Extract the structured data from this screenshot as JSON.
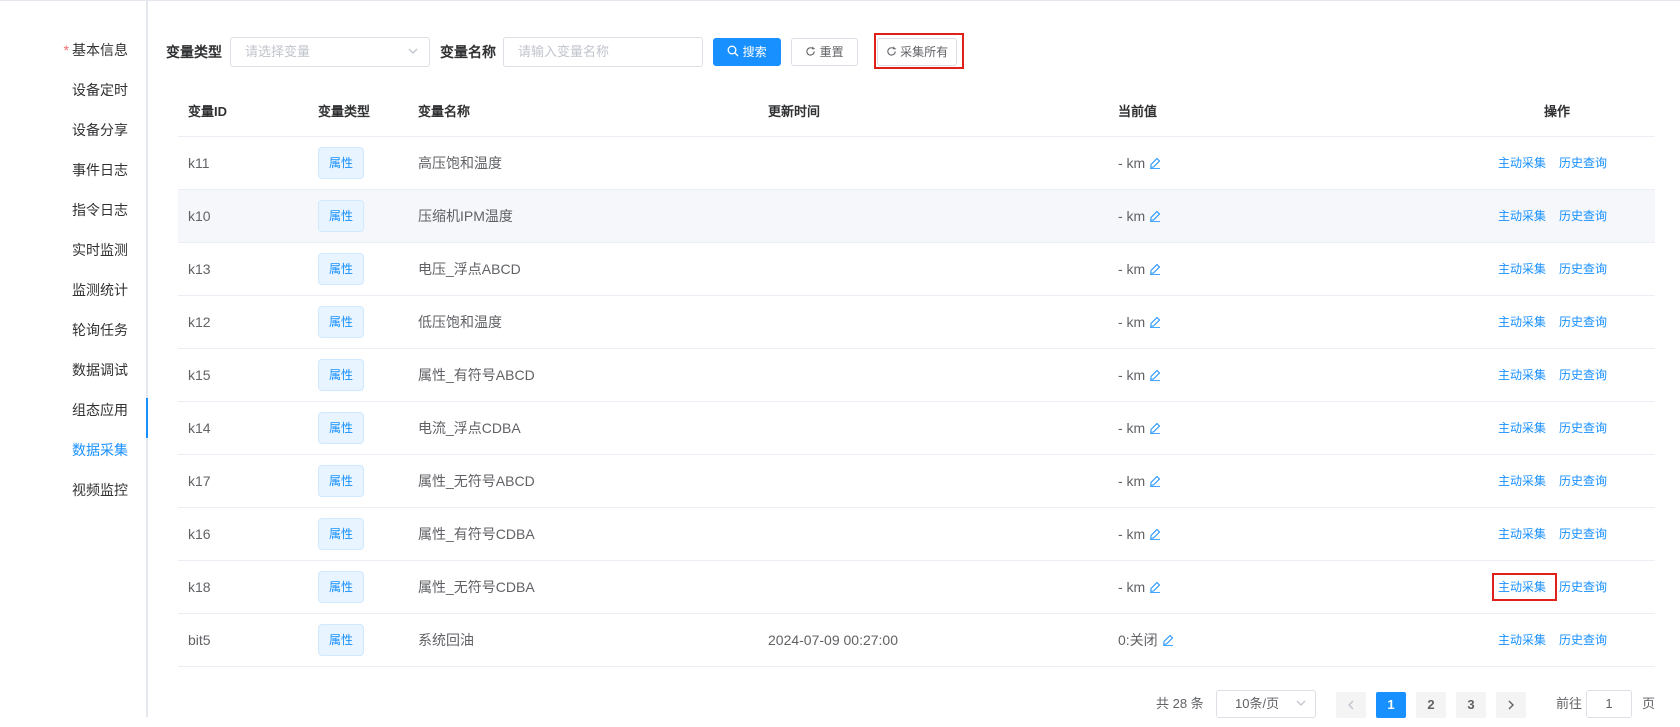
{
  "sidebar": {
    "items": [
      {
        "label": "基本信息",
        "required": "*"
      },
      {
        "label": "设备定时"
      },
      {
        "label": "设备分享"
      },
      {
        "label": "事件日志"
      },
      {
        "label": "指令日志"
      },
      {
        "label": "实时监测"
      },
      {
        "label": "监测统计"
      },
      {
        "label": "轮询任务"
      },
      {
        "label": "数据调试"
      },
      {
        "label": "组态应用"
      },
      {
        "label": "数据采集"
      },
      {
        "label": "视频监控"
      }
    ],
    "active_index": 10
  },
  "toolbar": {
    "type_label": "变量类型",
    "type_placeholder": "请选择变量",
    "name_label": "变量名称",
    "name_placeholder": "请输入变量名称",
    "search_label": "搜索",
    "reset_label": "重置",
    "collect_all_label": "采集所有"
  },
  "table": {
    "headers": [
      "变量ID",
      "变量类型",
      "变量名称",
      "更新时间",
      "当前值",
      "操作"
    ],
    "rows": [
      {
        "id": "k11",
        "type": "属性",
        "name": "高压饱和温度",
        "time": "",
        "value": "- km"
      },
      {
        "id": "k10",
        "type": "属性",
        "name": "压缩机IPM温度",
        "time": "",
        "value": "- km"
      },
      {
        "id": "k13",
        "type": "属性",
        "name": "电压_浮点ABCD",
        "time": "",
        "value": "- km"
      },
      {
        "id": "k12",
        "type": "属性",
        "name": "低压饱和温度",
        "time": "",
        "value": "- km"
      },
      {
        "id": "k15",
        "type": "属性",
        "name": "属性_有符号ABCD",
        "time": "",
        "value": "- km"
      },
      {
        "id": "k14",
        "type": "属性",
        "name": "电流_浮点CDBA",
        "time": "",
        "value": "- km"
      },
      {
        "id": "k17",
        "type": "属性",
        "name": "属性_无符号ABCD",
        "time": "",
        "value": "- km"
      },
      {
        "id": "k16",
        "type": "属性",
        "name": "属性_有符号CDBA",
        "time": "",
        "value": "- km"
      },
      {
        "id": "k18",
        "type": "属性",
        "name": "属性_无符号CDBA",
        "time": "",
        "value": "- km"
      },
      {
        "id": "bit5",
        "type": "属性",
        "name": "系统回油",
        "time": "2024-07-09 00:27:00",
        "value": "0:关闭"
      }
    ],
    "op_collect": "主动采集",
    "op_history": "历史查询"
  },
  "pagination": {
    "total": "共 28 条",
    "page_size": "10条/页",
    "pages": [
      "1",
      "2",
      "3"
    ],
    "current": "1",
    "goto_prefix": "前往",
    "goto_value": "1",
    "goto_suffix": "页"
  },
  "colors": {
    "accent": "#1890ff",
    "highlight": "#e0201b"
  }
}
